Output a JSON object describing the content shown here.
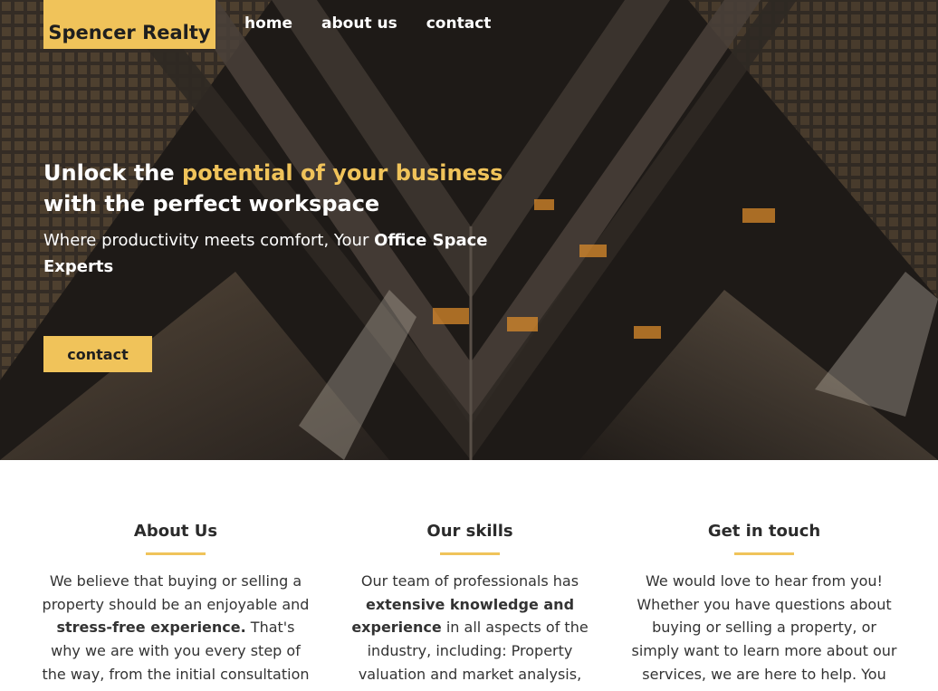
{
  "brand": {
    "name": "Spencer Realty",
    "accent_color": "#f0c35a"
  },
  "nav": {
    "items": [
      "home",
      "about us",
      "contact"
    ]
  },
  "hero": {
    "headline_part1": "Unlock the ",
    "headline_accent": "potential of your business",
    "headline_part2": "with the perfect workspace",
    "subline_text": "Where productivity meets comfort, Your ",
    "subline_bold": "Office Space Experts",
    "cta_label": "contact"
  },
  "about": {
    "title": "About Us",
    "text_1": "We believe that buying or selling a property should be an enjoyable and ",
    "text_bold": "stress-free experience.",
    "text_2": " That's why we are with you every step of the way, from the initial consultation"
  },
  "skills": {
    "title": "Our skills",
    "text_1": "Our team of professionals has ",
    "text_bold": "extensive knowledge and experience",
    "text_2": " in all aspects of the industry, including: Property valuation and market analysis,"
  },
  "contact": {
    "title": "Get in touch",
    "text": "We would love to hear from you! Whether you have questions about buying or selling a property, or simply want to learn more about our services, we are here to help. You"
  }
}
